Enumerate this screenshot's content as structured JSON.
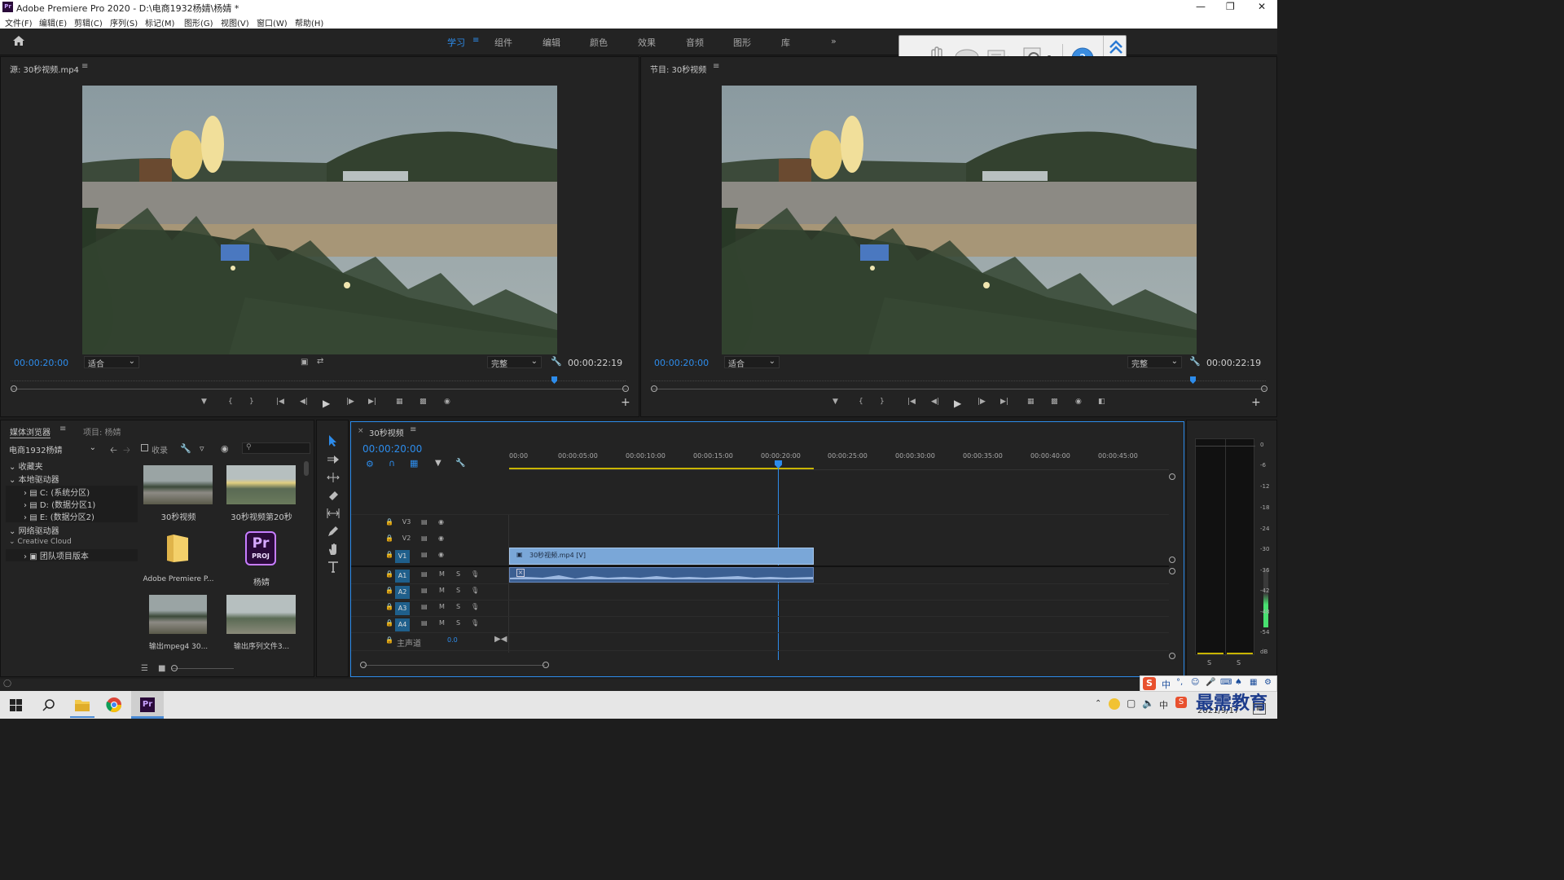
{
  "window": {
    "title": "Adobe Premiere Pro 2020 - D:\\电商1932杨婧\\杨婧 *",
    "app_icon": "Pr",
    "controls": [
      "minimize-icon",
      "restore-icon",
      "close-icon"
    ]
  },
  "menu": [
    "文件(F)",
    "编辑(E)",
    "剪辑(C)",
    "序列(S)",
    "标记(M)",
    "图形(G)",
    "视图(V)",
    "窗口(W)",
    "帮助(H)"
  ],
  "workspaces": {
    "items": [
      "学习",
      "组件",
      "编辑",
      "颜色",
      "效果",
      "音频",
      "图形",
      "库"
    ],
    "active": "学习",
    "more": "»"
  },
  "source_monitor": {
    "title": "源: 30秒视频.mp4",
    "timecode": "00:00:20:00",
    "fit": "适合",
    "quality": "完整",
    "duration": "00:00:22:19"
  },
  "program_monitor": {
    "title": "节目: 30秒视频",
    "timecode": "00:00:20:00",
    "fit": "适合",
    "quality": "完整",
    "duration": "00:00:22:19"
  },
  "media_browser": {
    "tab_active": "媒体浏览器",
    "tab_other": "项目: 杨婧",
    "location": "电商1932杨婧",
    "favorites_label": "收录",
    "tree": [
      {
        "label": "收藏夹",
        "level": 0
      },
      {
        "label": "本地驱动器",
        "level": 0
      },
      {
        "label": "C: (系统分区)",
        "level": 1
      },
      {
        "label": "D: (数据分区1)",
        "level": 1
      },
      {
        "label": "E: (数据分区2)",
        "level": 1
      },
      {
        "label": "网络驱动器",
        "level": 0
      },
      {
        "label": "Creative Cloud",
        "level": 0
      },
      {
        "label": "团队项目版本",
        "level": 1
      }
    ],
    "items": [
      {
        "caption": "30秒视频",
        "kind": "video"
      },
      {
        "caption": "30秒视频第20秒",
        "kind": "video"
      },
      {
        "caption": "Adobe Premiere P...",
        "kind": "folder"
      },
      {
        "caption": "杨婧",
        "kind": "proj",
        "badge": "Pr",
        "badge_sub": "PROJ"
      },
      {
        "caption": "输出mpeg4 30...",
        "kind": "video"
      },
      {
        "caption": "输出序列文件3...",
        "kind": "video"
      }
    ]
  },
  "tools": [
    "selection-tool-icon",
    "track-select-icon",
    "ripple-edit-icon",
    "razor-icon",
    "slip-icon",
    "pen-icon",
    "hand-icon",
    "type-icon"
  ],
  "timeline": {
    "tab": "30秒视频",
    "timecode": "00:00:20:00",
    "ruler": [
      "00:00",
      "00:00:05:00",
      "00:00:10:00",
      "00:00:15:00",
      "00:00:20:00",
      "00:00:25:00",
      "00:00:30:00",
      "00:00:35:00",
      "00:00:40:00",
      "00:00:45:00"
    ],
    "video_tracks": [
      "V3",
      "V2",
      "V1"
    ],
    "audio_tracks": [
      "A1",
      "A2",
      "A3",
      "A4"
    ],
    "clip_video": "30秒视频.mp4 [V]",
    "master_label": "主声道",
    "master_value": "0.0",
    "mute": "M",
    "solo": "S"
  },
  "audio_meter": {
    "scale": [
      "0",
      "-6",
      "-12",
      "-18",
      "-24",
      "-30",
      "-36",
      "-42",
      "-48",
      "-54",
      "dB"
    ],
    "solo": [
      "S",
      "S"
    ]
  },
  "taskbar": {
    "date": "2021/9/17",
    "ime": "中",
    "watermark": "最需教育"
  },
  "colors": {
    "accent": "#2d8ceb",
    "clip_video": "#7aa7d8",
    "clip_audio": "#3b5f92"
  }
}
